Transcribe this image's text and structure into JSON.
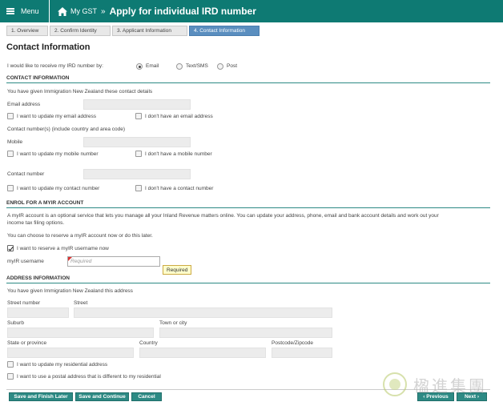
{
  "header": {
    "menu_label": "Menu",
    "crumb": "My GST",
    "separator": "»",
    "title": "Apply for individual IRD number"
  },
  "steps": [
    {
      "label": "1. Overview"
    },
    {
      "label": "2. Confirm Identity"
    },
    {
      "label": "3. Applicant Information"
    },
    {
      "label": "4. Contact Information"
    }
  ],
  "page_heading": "Contact Information",
  "receive": {
    "question": "I would like to receive my IRD number by:",
    "options": [
      "Email",
      "Text/SMS",
      "Post"
    ],
    "selected": "Email"
  },
  "contact": {
    "section_title": "CONTACT INFORMATION",
    "intro": "You have given Immigration New Zealand these contact details",
    "email_label": "Email address",
    "update_email": "I want to update my email address",
    "no_email": "I don't have an email address",
    "numbers_label": "Contact number(s) (include country and area code)",
    "mobile_label": "Mobile",
    "update_mobile": "I want to update my mobile number",
    "no_mobile": "I don't have a mobile number",
    "contact_label": "Contact number",
    "update_contact": "I want to update my contact number",
    "no_contact": "I don't have a contact number"
  },
  "myir": {
    "section_title": "ENROL FOR A MYIR ACCOUNT",
    "desc_line1": "A myIR account is an optional service that lets you manage all your Inland Revenue matters online. You can update your address, phone, email and bank account details and work out your",
    "desc_line2": "income tax filing options.",
    "choose": "You can choose to reserve a myIR account now or do this later.",
    "reserve": "I want to reserve a myIR username now",
    "username_label": "myIR username",
    "username_placeholder": "Required",
    "tooltip": "Required"
  },
  "address": {
    "section_title": "ADDRESS INFORMATION",
    "intro": "You have given Immigration New Zealand this address",
    "street_number": "Street number",
    "street": "Street",
    "suburb": "Suburb",
    "town": "Town or city",
    "state": "State or province",
    "country": "Country",
    "postcode": "Postcode/Zipcode",
    "update_residential": "I want to update my residential address",
    "postal_different": "I want to use a postal address that is different to my residential"
  },
  "buttons": {
    "save_finish": "Save and Finish Later",
    "save_continue": "Save and Continue",
    "cancel": "Cancel",
    "previous": "‹ Previous",
    "next": "Next ›"
  },
  "watermark": {
    "text": "楹進集團"
  },
  "colors": {
    "brand": "#0e7a73",
    "active_step": "#5a8ebf",
    "button": "#2d8a84"
  }
}
